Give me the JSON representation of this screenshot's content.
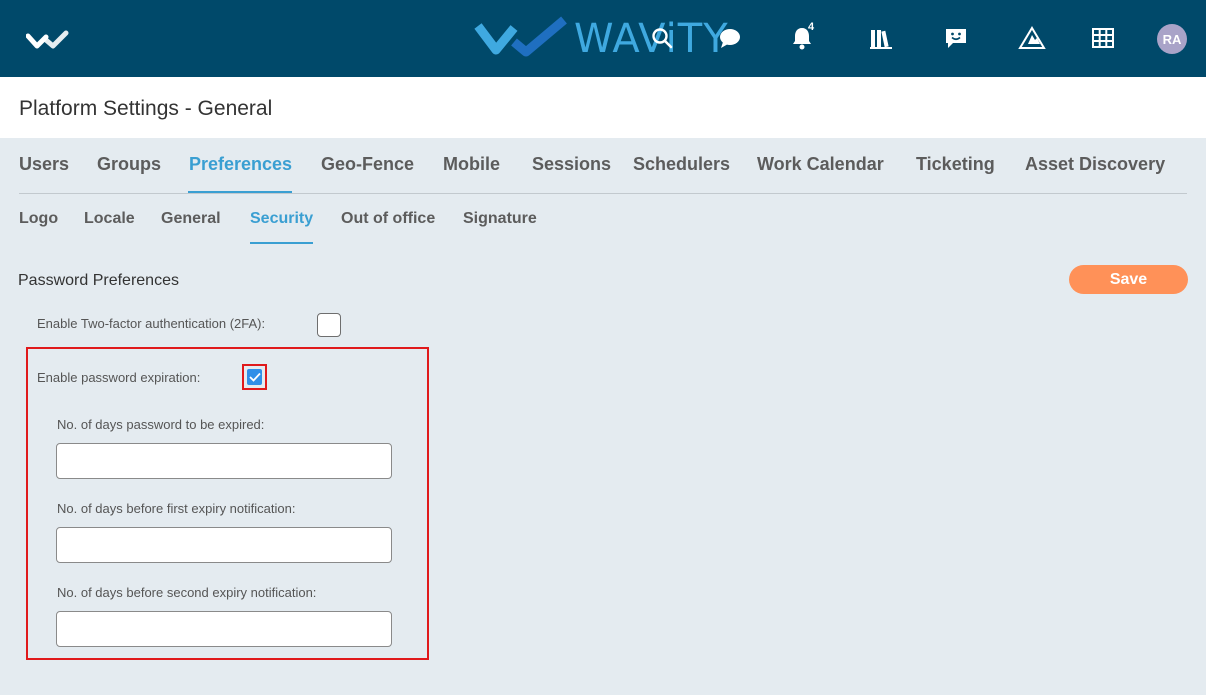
{
  "header": {
    "brand_name": "WAViTY",
    "notification_count": "4",
    "avatar_initials": "RA",
    "icons": [
      "logo-check-icon",
      "search-icon",
      "chat-bubble-icon",
      "bell-icon",
      "library-icon",
      "message-smile-icon",
      "road-sign-icon",
      "grid-icon"
    ],
    "brand_color": "#3fa9e0",
    "bar_color": "#00496a"
  },
  "page": {
    "title": "Platform Settings - General"
  },
  "tabs": [
    {
      "label": "Users"
    },
    {
      "label": "Groups"
    },
    {
      "label": "Preferences",
      "active": true
    },
    {
      "label": "Geo-Fence"
    },
    {
      "label": "Mobile"
    },
    {
      "label": "Sessions"
    },
    {
      "label": "Schedulers"
    },
    {
      "label": "Work Calendar"
    },
    {
      "label": "Ticketing"
    },
    {
      "label": "Asset Discovery"
    }
  ],
  "subtabs": [
    {
      "label": "Logo"
    },
    {
      "label": "Locale"
    },
    {
      "label": "General"
    },
    {
      "label": "Security",
      "active": true
    },
    {
      "label": "Out of office"
    },
    {
      "label": "Signature"
    }
  ],
  "form": {
    "section_title": "Password Preferences",
    "save_label": "Save",
    "two_factor_label": "Enable Two-factor authentication (2FA):",
    "two_factor_checked": false,
    "expiration_label": "Enable password expiration:",
    "expiration_checked": true,
    "days_expire_label": "No. of days password to be expired:",
    "days_expire_value": "",
    "first_notification_label": "No. of days before first expiry notification:",
    "first_notification_value": "",
    "second_notification_label": "No. of days before second expiry notification:",
    "second_notification_value": ""
  },
  "colors": {
    "accent": "#3a9fd2",
    "save_button": "#ff9158",
    "highlight": "#e0191b",
    "background": "#e4ebf0"
  }
}
